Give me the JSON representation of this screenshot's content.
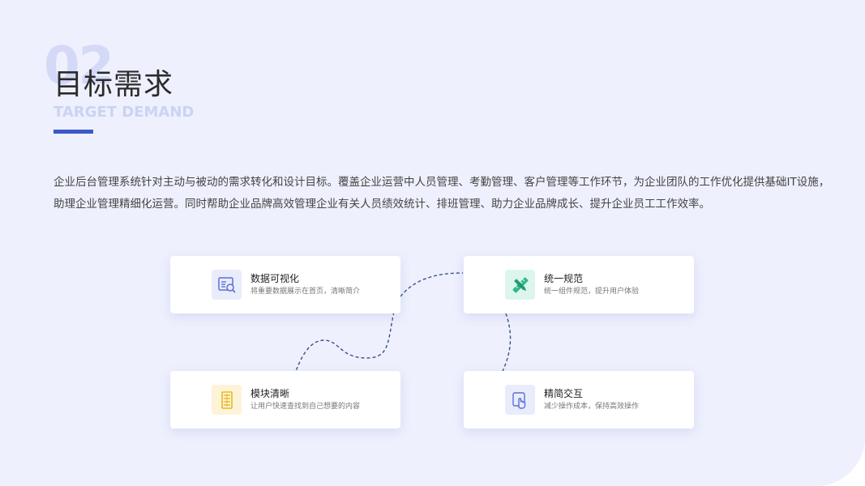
{
  "header": {
    "number": "02",
    "title": "目标需求",
    "subtitle": "TARGET DEMAND"
  },
  "description": "企业后台管理系统针对主动与被动的需求转化和设计目标。覆盖企业运营中人员管理、考勤管理、客户管理等工作环节，为企业团队的工作优化提供基础IT设施，助理企业管理精细化运营。同时帮助企业品牌高效管理企业有关人员绩效统计、排班管理、助力企业品牌成长、提升企业员工工作效率。",
  "cards": [
    {
      "title": "数据可视化",
      "subtitle": "将重要数据展示在首页，清晰简介",
      "icon": "data-visual-icon",
      "icon_bg": "#e9ecfb",
      "icon_color": "#5b6fd6"
    },
    {
      "title": "统一规范",
      "subtitle": "统一组件规范，提升用户体验",
      "icon": "ruler-pencil-icon",
      "icon_bg": "#dcf6ee",
      "icon_color": "#2fb88a"
    },
    {
      "title": "模块清晰",
      "subtitle": "让用户快速查找到自己想要的内容",
      "icon": "module-icon",
      "icon_bg": "#fdf3d8",
      "icon_color": "#e8b923"
    },
    {
      "title": "精简交互",
      "subtitle": "减少操作成本，保持高效操作",
      "icon": "touch-icon",
      "icon_bg": "#e9ecfb",
      "icon_color": "#5b6fd6"
    }
  ],
  "colors": {
    "background": "#eef0fd",
    "accent": "#3c58c9"
  }
}
